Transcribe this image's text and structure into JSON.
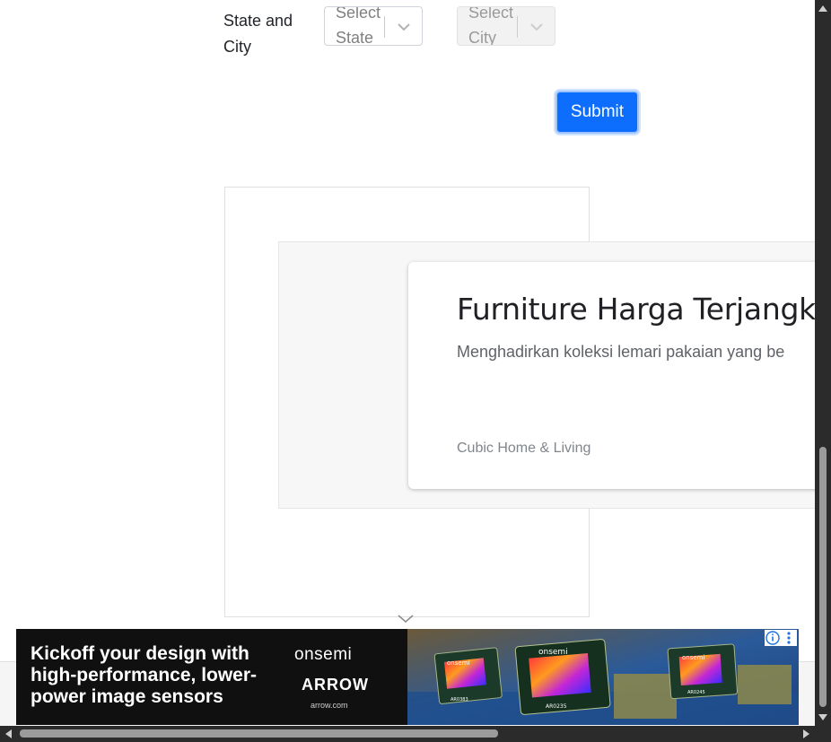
{
  "form": {
    "label": "State and City",
    "state_select": {
      "placeholder": "Select State"
    },
    "city_select": {
      "placeholder": "Select City"
    },
    "submit_label": "Submit"
  },
  "ad_card": {
    "title": "Furniture Harga Terjangk",
    "description": "Menghadirkan koleksi lemari pakaian yang be",
    "brand": "Cubic Home & Living"
  },
  "banner": {
    "headline": "Kickoff your design with high-performance, lower-power image sensors",
    "brand1": "onsemi",
    "brand2": "ARROW",
    "url": "arrow.com",
    "chip_labels": [
      "onsemi",
      "onsemi",
      "onsemi"
    ],
    "chip_codes": [
      "AR0383",
      "AR0235",
      "AR0245"
    ]
  },
  "colors": {
    "submit_bg": "#0d6efd",
    "banner_bg": "#101010",
    "ad_choices": "#1a73e8",
    "scrollbar": "#2b2b2b"
  },
  "icons": [
    "chevron-down-icon",
    "chevron-down-icon",
    "ad-choices-icon",
    "more-vert-icon",
    "chevron-down-icon",
    "arrow-up-icon",
    "arrow-down-icon",
    "arrow-left-icon",
    "arrow-right-icon"
  ]
}
